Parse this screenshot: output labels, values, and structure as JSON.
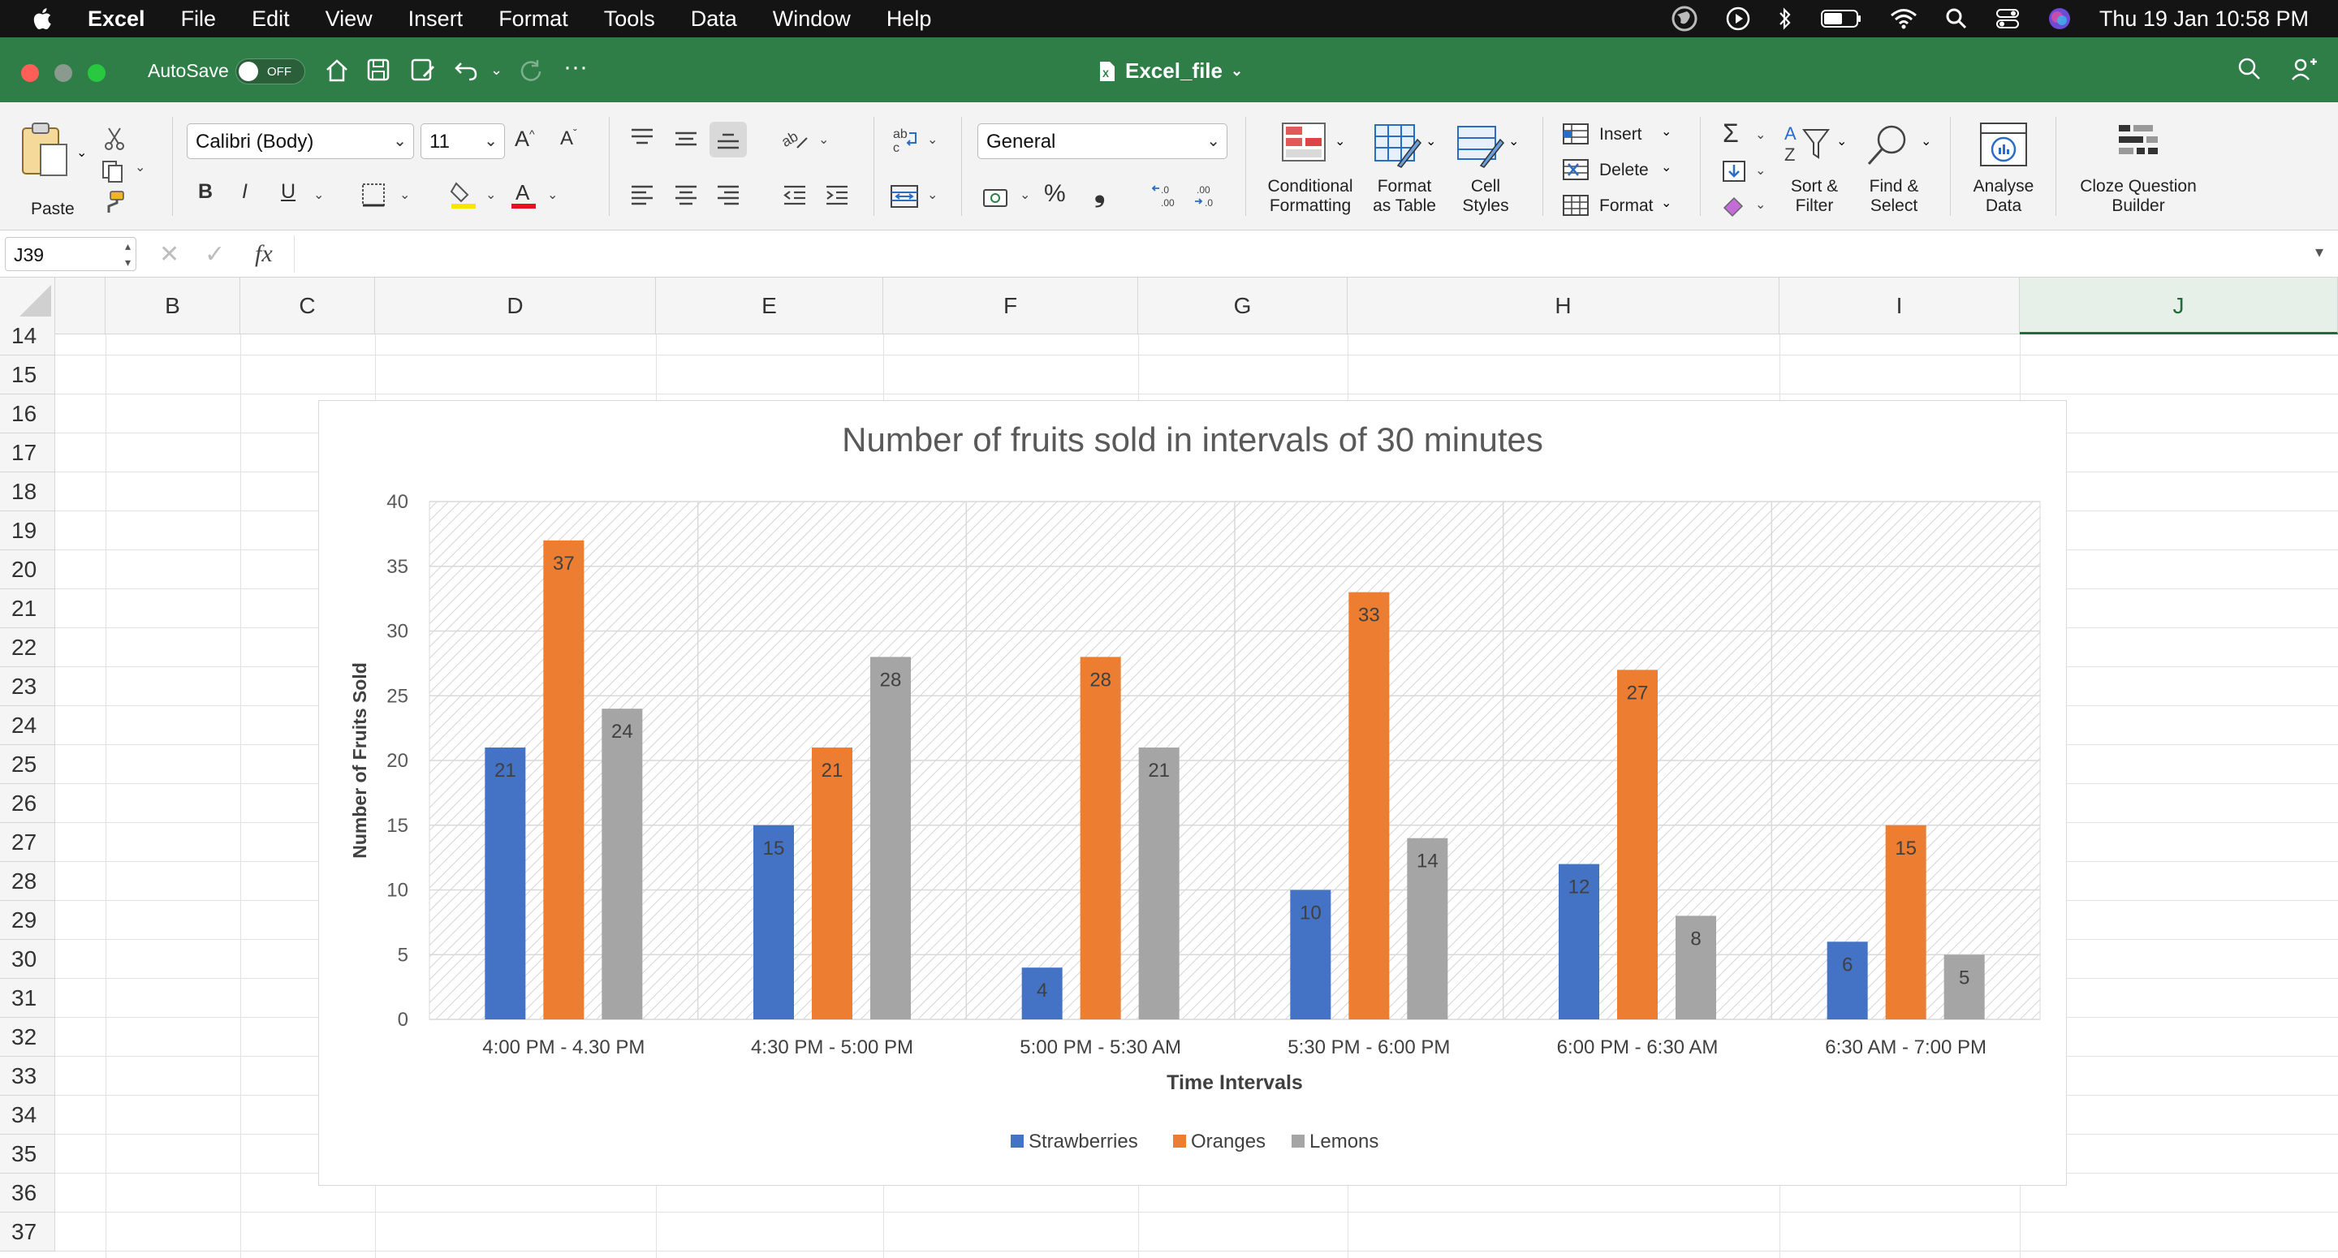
{
  "menubar": {
    "app_name": "Excel",
    "items": [
      "File",
      "Edit",
      "View",
      "Insert",
      "Format",
      "Tools",
      "Data",
      "Window",
      "Help"
    ],
    "datetime": "Thu 19 Jan  10:58 PM"
  },
  "titlebar": {
    "autosave_label": "AutoSave",
    "autosave_state": "OFF",
    "document_title": "Excel_file"
  },
  "ribbon": {
    "paste_label": "Paste",
    "font_name": "Calibri (Body)",
    "font_size": "11",
    "number_format": "General",
    "conditional_formatting": "Conditional\nFormatting",
    "format_as_table": "Format\nas Table",
    "cell_styles": "Cell\nStyles",
    "insert_label": "Insert",
    "delete_label": "Delete",
    "format_label": "Format",
    "sort_filter": "Sort &\nFilter",
    "find_select": "Find &\nSelect",
    "analyse_data": "Analyse\nData",
    "cloze_builder": "Cloze Question\nBuilder",
    "bold": "B",
    "italic": "I",
    "underline": "U",
    "percent": "%"
  },
  "formula_bar": {
    "name_box": "J39",
    "fx": "fx",
    "formula": ""
  },
  "grid": {
    "columns": [
      "B",
      "C",
      "D",
      "E",
      "F",
      "G",
      "H",
      "I",
      "J"
    ],
    "selected_column": "J",
    "rows": [
      "14",
      "15",
      "16",
      "17",
      "18",
      "19",
      "20",
      "21",
      "22",
      "23",
      "24",
      "25",
      "26",
      "27",
      "28",
      "29",
      "30",
      "31",
      "32",
      "33",
      "34",
      "35",
      "36",
      "37"
    ]
  },
  "chart_data": {
    "type": "bar",
    "title": "Number of fruits sold in intervals of 30 minutes",
    "xlabel": "Time Intervals",
    "ylabel": "Number of Fruits Sold",
    "ylim": [
      0,
      40
    ],
    "yticks": [
      0,
      5,
      10,
      15,
      20,
      25,
      30,
      35,
      40
    ],
    "grid": true,
    "legend": "bottom",
    "categories": [
      "4:00 PM - 4.30 PM",
      "4:30 PM - 5:00 PM",
      "5:00 PM - 5:30 AM",
      "5:30 PM - 6:00 PM",
      "6:00 PM - 6:30 AM",
      "6:30 AM - 7:00 PM"
    ],
    "series": [
      {
        "name": "Strawberries",
        "color": "#4472c4",
        "values": [
          21,
          15,
          4,
          10,
          12,
          6
        ]
      },
      {
        "name": "Oranges",
        "color": "#ed7d31",
        "values": [
          37,
          21,
          28,
          33,
          27,
          15
        ]
      },
      {
        "name": "Lemons",
        "color": "#a5a5a5",
        "values": [
          24,
          28,
          21,
          14,
          8,
          5
        ]
      }
    ]
  }
}
